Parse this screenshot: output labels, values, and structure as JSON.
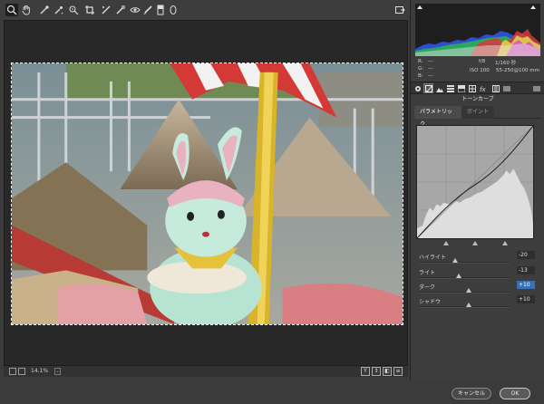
{
  "toolbar": {
    "tools": [
      "zoom-icon",
      "hand-icon",
      "white-balance-icon",
      "color-sampler-icon",
      "target-adjust-icon",
      "crop-icon",
      "straighten-icon",
      "spot-removal-icon",
      "red-eye-icon",
      "adjustment-brush-icon",
      "graduated-filter-icon",
      "radial-filter-icon"
    ],
    "open_preferences_icon": "preferences-icon"
  },
  "status": {
    "zoom": "14.1%",
    "view_buttons": [
      "Y",
      "↕",
      "◧",
      "≡"
    ]
  },
  "meta": {
    "r_label": "R:",
    "g_label": "G:",
    "b_label": "B:",
    "r_value": "---",
    "g_value": "---",
    "b_value": "---",
    "aperture": "f/8",
    "shutter": "1/160 秒",
    "iso": "ISO 100",
    "lens": "55-250@100 mm"
  },
  "panel": {
    "section_title": "トーンカーブ",
    "subtabs": {
      "parametric": "パラメトリック",
      "point": "ポイント"
    },
    "sliders": [
      {
        "label": "ハイライト",
        "value": "-20",
        "level": 0.4
      },
      {
        "label": "ライト",
        "value": "-13",
        "level": 0.44
      },
      {
        "label": "ダーク",
        "value": "+10",
        "level": 0.55
      },
      {
        "label": "シャドウ",
        "value": "+10",
        "level": 0.55
      }
    ],
    "curve_split_points": [
      0.25,
      0.5,
      0.75
    ]
  },
  "buttons": {
    "cancel": "キャンセル",
    "ok": "OK"
  },
  "colors": {
    "focus_blue": "#3b6fb5",
    "panel_bg": "#3d3d3d",
    "canvas_bg": "#282828"
  }
}
